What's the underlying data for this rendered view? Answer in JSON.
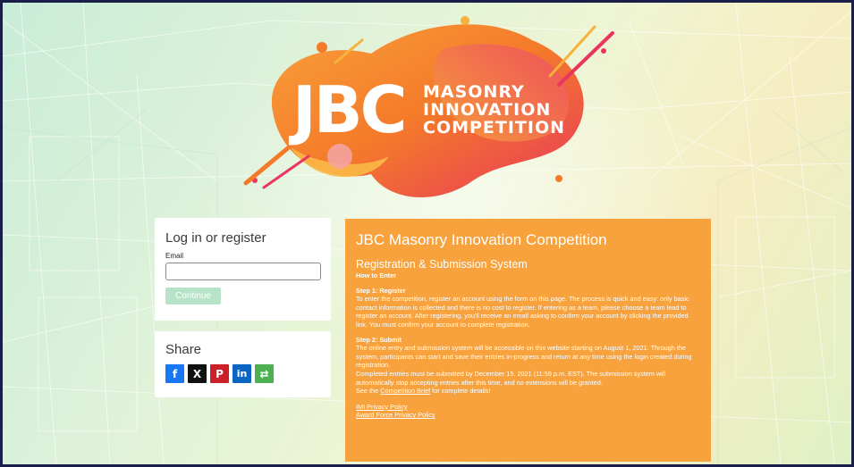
{
  "logo": {
    "brand": "JBC",
    "lines": [
      "MASONRY",
      "INNOVATION",
      "COMPETITION"
    ]
  },
  "login": {
    "title": "Log in or register",
    "email_label": "Email",
    "email_value": "",
    "continue_label": "Continue"
  },
  "share": {
    "title": "Share",
    "buttons": [
      {
        "icon": "facebook-icon",
        "glyph": "f",
        "color": "#1877f2"
      },
      {
        "icon": "x-icon",
        "glyph": "X",
        "color": "#111111"
      },
      {
        "icon": "pinterest-icon",
        "glyph": "P",
        "color": "#cb2027"
      },
      {
        "icon": "linkedin-icon",
        "glyph": "in",
        "color": "#0a66c2"
      },
      {
        "icon": "more-share-icon",
        "glyph": "⇄",
        "color": "#4caf50"
      }
    ]
  },
  "info": {
    "title": "JBC Masonry Innovation Competition",
    "subtitle": "Registration & Submission System",
    "how_to": "How to Enter",
    "step1_heading": "Step 1: Register",
    "step1_text": "To enter the competition, register an account using the form on this page. The process is quick and easy: only basic contact information is collected and there is no cost to register. If entering as a team, please choose a team lead to register an account. After registering, you'll receive an email asking to confirm your account by clicking the provided link. You must confirm your account to complete registration.",
    "step2_heading": "Step 2: Submit",
    "step2_text": "The online entry and submission system will be accessible on this website starting on August 1, 2021. Through the system, participants can start and save their entries in-progress and return at any time using the login created during registration.",
    "deadline_text": "Completed entries must be submitted by December 15, 2021 (11:59 p.m. EST). The submission system will automatically stop accepting entries after this time, and no extensions will be granted.",
    "brief_prefix": "See the ",
    "brief_link": "Competition Brief",
    "brief_suffix": " for complete details!",
    "privacy_links": [
      "IMI Privacy Policy",
      "Award Force Privacy Policy"
    ]
  },
  "colors": {
    "panel": "#f7a23c",
    "continue_button": "#b7e3c9",
    "logo_orange": "#f47a2a",
    "logo_pink": "#e8365d"
  }
}
